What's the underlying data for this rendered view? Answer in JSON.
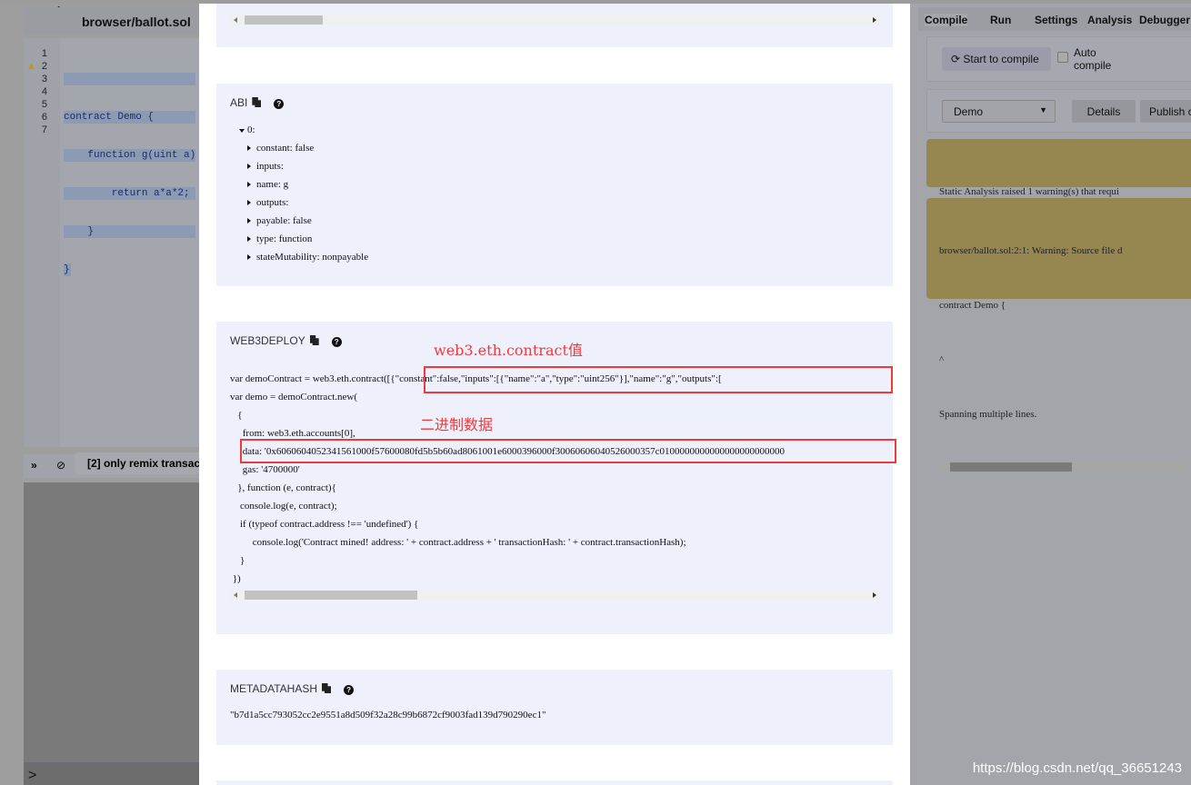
{
  "editor": {
    "tab": "browser/ballot.sol",
    "line_numbers": [
      "1",
      "2",
      "3",
      "4",
      "5",
      "6",
      "7"
    ],
    "code": [
      "",
      "contract Demo {",
      "    function g(uint a)",
      "        return a*a*2;",
      "    }",
      "}",
      ""
    ]
  },
  "terminal": {
    "filter": "[2] only remix transac",
    "prompt": ">"
  },
  "right_panel": {
    "tabs": [
      "Compile",
      "Run",
      "Settings",
      "Analysis",
      "Debugger"
    ],
    "compile_button": "Start to compile",
    "auto_compile": "Auto compile",
    "auto_compile_checked": false,
    "contract_select": "Demo",
    "details_button": "Details",
    "publish_button": "Publish o",
    "warning1": "Static Analysis raised 1 warning(s) that requi",
    "warning2": [
      "browser/ballot.sol:2:1: Warning: Source file d",
      "contract Demo {",
      "^",
      "",
      "Spanning multiple lines."
    ]
  },
  "modal": {
    "abi": {
      "title": "ABI",
      "root": "0:",
      "items": [
        "constant: false",
        "inputs:",
        "name: g",
        "outputs:",
        "payable: false",
        "type: function",
        "stateMutability: nonpayable"
      ]
    },
    "web3deploy": {
      "title": "WEB3DEPLOY",
      "lines": [
        "var demoContract = web3.eth.contract([{\"constant\":false,\"inputs\":[{\"name\":\"a\",\"type\":\"uint256\"}],\"name\":\"g\",\"outputs\":[",
        "var demo = demoContract.new(",
        "   {",
        "     from: web3.eth.accounts[0],",
        "     data: '0x6060604052341561000f57600080fd5b5b60ad8061001e6000396000f30060606040526000357c0100000000000000000000000",
        "     gas: '4700000'",
        "   }, function (e, contract){",
        "    console.log(e, contract);",
        "    if (typeof contract.address !== 'undefined') {",
        "         console.log('Contract mined! address: ' + contract.address + ' transactionHash: ' + contract.transactionHash);",
        "    }",
        " })"
      ]
    },
    "metadatahash": {
      "title": "METADATAHASH",
      "value": "\"b7d1a5cc793052cc2e9551a8d509f32a28c99b6872cf9003fad139d790290ec1\""
    },
    "help_glyph": "?"
  },
  "annotations": {
    "contract_value": "web3.eth.contract值",
    "binary_data": "二进制数据"
  },
  "watermark": "https://blog.csdn.net/qq_36651243"
}
